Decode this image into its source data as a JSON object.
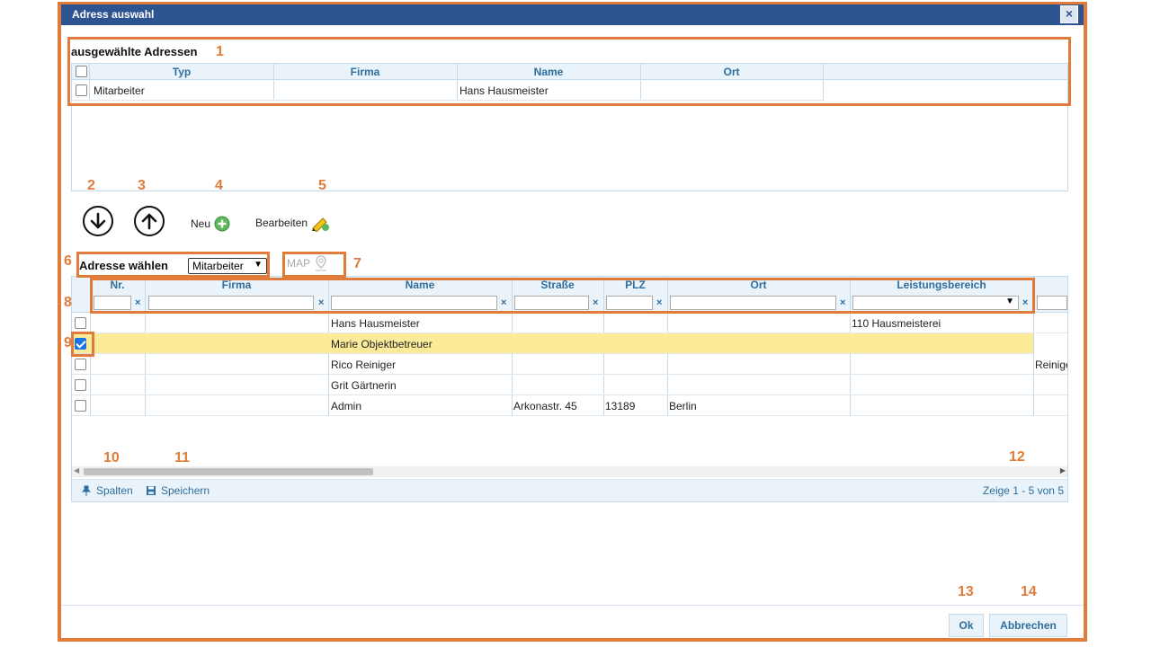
{
  "dialog": {
    "title": "Adress auswahl",
    "close_label": "×"
  },
  "selected": {
    "title": "ausgewählte Adressen",
    "columns": [
      "Typ",
      "Firma",
      "Name",
      "Ort"
    ],
    "rows": [
      {
        "typ": "Mitarbeiter",
        "firma": "",
        "name": "Hans Hausmeister",
        "ort": ""
      }
    ]
  },
  "toolbar": {
    "new_label": "Neu",
    "edit_label": "Bearbeiten"
  },
  "chooser": {
    "label": "Adresse wählen",
    "select_value": "Mitarbeiter",
    "map_label": "MAP"
  },
  "grid": {
    "columns": [
      "Nr.",
      "Firma",
      "Name",
      "Straße",
      "PLZ",
      "Ort",
      "Leistungsbereich"
    ],
    "filter_clear": "×",
    "rows": [
      {
        "checked": false,
        "nr": "",
        "firma": "",
        "name": "Hans Hausmeister",
        "strasse": "",
        "plz": "",
        "ort": "",
        "leistung": "110 Hausmeisterei",
        "extra": ""
      },
      {
        "checked": true,
        "nr": "",
        "firma": "",
        "name": "Marie Objektbetreuer",
        "strasse": "",
        "plz": "",
        "ort": "",
        "leistung": "",
        "extra": ""
      },
      {
        "checked": false,
        "nr": "",
        "firma": "",
        "name": "Rico Reiniger",
        "strasse": "",
        "plz": "",
        "ort": "",
        "leistung": "",
        "extra": "Reinige"
      },
      {
        "checked": false,
        "nr": "",
        "firma": "",
        "name": "Grit Gärtnerin",
        "strasse": "",
        "plz": "",
        "ort": "",
        "leistung": "",
        "extra": ""
      },
      {
        "checked": false,
        "nr": "",
        "firma": "",
        "name": "Admin",
        "strasse": "Arkonastr. 45",
        "plz": "13189",
        "ort": "Berlin",
        "leistung": "",
        "extra": ""
      }
    ],
    "footer": {
      "columns_label": "Spalten",
      "save_label": "Speichern",
      "pager_text": "Zeige 1 - 5 von 5"
    }
  },
  "buttons": {
    "ok_label": "Ok",
    "cancel_label": "Abbrechen"
  },
  "annotations": [
    "1",
    "2",
    "3",
    "4",
    "5",
    "6",
    "7",
    "8",
    "9",
    "10",
    "11",
    "12",
    "13",
    "14"
  ],
  "colors": {
    "annotation": "#e07b39",
    "titlebar": "#2e5391",
    "header_text": "#2e6e9e",
    "selected_row": "#fcec9a",
    "grid_border": "#c5dbec"
  }
}
